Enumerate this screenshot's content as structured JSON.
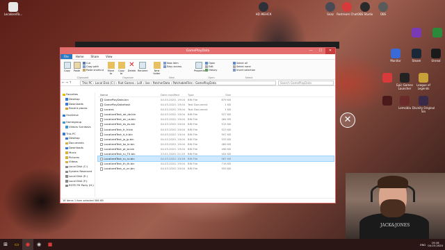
{
  "desktop": {
    "top_left_icon": {
      "label": "LocalizedTa...",
      "color": "#e8e8e8"
    },
    "top_icons": [
      {
        "label": "HD ЖЕНСК",
        "color": "#303038"
      },
      {
        "label": "Snaz",
        "color": "#4a4a55"
      },
      {
        "label": "Restream Chat",
        "color": "#d63a3a"
      },
      {
        "label": "OBS Studio",
        "color": "#2a2a2a"
      },
      {
        "label": "OBS",
        "color": "#5a5a5a"
      }
    ],
    "right_icons": [
      {
        "label": "Monitor",
        "color": "#3a6ad6"
      },
      {
        "label": "Steam",
        "color": "#1b2838"
      },
      {
        "label": "Unreal",
        "color": "#1a1a1a"
      },
      {
        "label": "",
        "color": "#7a3ab6"
      },
      {
        "label": "",
        "color": "#2a8a3a"
      },
      {
        "label": "",
        "color": "#d63a3a"
      },
      {
        "label": "Epic Games Launcher",
        "color": "#222222"
      },
      {
        "label": "League of Legends",
        "color": "#c8a03a"
      },
      {
        "label": "",
        "color": "#4a1a1a"
      },
      {
        "label": "Lemsidia",
        "color": "#6a2a2a"
      },
      {
        "label": "Divinity Original Sin",
        "color": "#3a2a4a"
      }
    ]
  },
  "overlay": {
    "close_glyph": "✕"
  },
  "explorer": {
    "title": "GamePlayData",
    "window_controls": [
      "—",
      "☐",
      "✕"
    ],
    "tabs": [
      "File",
      "Home",
      "Share",
      "View"
    ],
    "ribbon": {
      "clipboard": {
        "label": "Clipboard",
        "copy": "Copy",
        "paste": "Paste",
        "cut": "Cut",
        "copy_path": "Copy path",
        "paste_shortcut": "Paste shortcut"
      },
      "organize": {
        "label": "Organize",
        "move_to": "Move to",
        "copy_to": "Copy to",
        "delete": "Delete",
        "rename": "Rename"
      },
      "new": {
        "label": "New",
        "new_folder": "New folder",
        "new_item": "New item",
        "easy_access": "Easy access"
      },
      "open": {
        "label": "Open",
        "properties": "Properties",
        "open": "Open",
        "edit": "Edit",
        "history": "History"
      },
      "select": {
        "label": "Select",
        "select_all": "Select all",
        "select_none": "Select none",
        "invert": "Invert selection"
      }
    },
    "address": {
      "nav": "← → ↑",
      "path": "This PC  ›  Local Disk (C:)  ›  Riot Games  ›  LoR  ›  live  ›  PatcherData  ›  PatchableFiles  ›  GamePlayData",
      "search_placeholder": "Search GamePlayData"
    },
    "nav_items": [
      {
        "label": "Favorites",
        "top": true,
        "color": "#e8b800"
      },
      {
        "label": "Desktop",
        "top": false,
        "color": "#3a7ad6"
      },
      {
        "label": "Downloads",
        "top": false,
        "color": "#3a7ad6"
      },
      {
        "label": "Recent places",
        "top": false,
        "color": "#d6a030"
      },
      {
        "label": "OneDrive",
        "top": true,
        "color": "#2a7ad6",
        "gap": true
      },
      {
        "label": "Homegroup",
        "top": true,
        "color": "#3a9ad6",
        "gap": true
      },
      {
        "label": "Viktors Sviridovs",
        "top": false,
        "color": "#3a9ad6"
      },
      {
        "label": "This PC",
        "top": true,
        "color": "#3a7ad6",
        "gap": true
      },
      {
        "label": "Desktop",
        "top": false,
        "color": "#3a7ad6"
      },
      {
        "label": "Documents",
        "top": false,
        "color": "#d6b040"
      },
      {
        "label": "Downloads",
        "top": false,
        "color": "#3a7ad6"
      },
      {
        "label": "Music",
        "top": false,
        "color": "#d6b040"
      },
      {
        "label": "Pictures",
        "top": false,
        "color": "#d6b040"
      },
      {
        "label": "Videos",
        "top": false,
        "color": "#d6b040"
      },
      {
        "label": "Local Disk (C:)",
        "top": false,
        "color": "#888888"
      },
      {
        "label": "System Reserved",
        "top": false,
        "color": "#888888"
      },
      {
        "label": "Local Disk (E:)",
        "top": false,
        "color": "#888888"
      },
      {
        "label": "Local Disk (F:)",
        "top": false,
        "color": "#888888"
      },
      {
        "label": "RGTE PH Party (H:)",
        "top": false,
        "color": "#888888"
      }
    ],
    "columns": [
      "Name",
      "Date modified",
      "Type",
      "Size"
    ],
    "files": [
      {
        "name": "GamePlayData.bin",
        "date": "04.03.2020. 19:04",
        "type": "BIN File",
        "size": "879 KB",
        "selected": false
      },
      {
        "name": "GamePlayDataHash",
        "date": "04.03.2020. 19:04",
        "type": "Text Document",
        "size": "1 KB",
        "selected": false
      },
      {
        "name": "Locales",
        "date": "04.03.2020. 19:04",
        "type": "Text Document",
        "size": "1 KB",
        "selected": false
      },
      {
        "name": "LocalizedText_de_de.bin",
        "date": "04.03.2020. 19:04",
        "type": "BIN File",
        "size": "527 KB",
        "selected": false
      },
      {
        "name": "LocalizedText_en_us.bin",
        "date": "04.03.2020. 19:04",
        "type": "BIN File",
        "size": "464 KB",
        "selected": false
      },
      {
        "name": "LocalizedText_es_es.bin",
        "date": "04.03.2020. 19:04",
        "type": "BIN File",
        "size": "515 KB",
        "selected": false
      },
      {
        "name": "LocalizedText_fr_fr.bin",
        "date": "04.03.2020. 19:04",
        "type": "BIN File",
        "size": "523 KB",
        "selected": false
      },
      {
        "name": "LocalizedText_it_it.bin",
        "date": "04.03.2020. 19:04",
        "type": "BIN File",
        "size": "507 KB",
        "selected": false
      },
      {
        "name": "LocalizedText_ja_jp.bin",
        "date": "04.03.2020. 19:04",
        "type": "BIN File",
        "size": "533 KB",
        "selected": false
      },
      {
        "name": "LocalizedText_ko_kr.bin",
        "date": "04.03.2020. 19:04",
        "type": "BIN File",
        "size": "489 KB",
        "selected": false
      },
      {
        "name": "LocalizedText_pt_br.bin",
        "date": "04.03.2020. 19:04",
        "type": "BIN File",
        "size": "496 KB",
        "selected": false
      },
      {
        "name": "LocalizedText_ru_TX.bin",
        "date": "23.01.2020. 21:25",
        "type": "BIN File",
        "size": "404 KB",
        "selected": false
      },
      {
        "name": "LocalizedText_ru_ru.bin",
        "date": "04.03.2020. 19:26",
        "type": "BIN File",
        "size": "587 KB",
        "selected": true
      },
      {
        "name": "LocalizedText_th_th.bin",
        "date": "04.03.2020. 19:04",
        "type": "BIN File",
        "size": "716 KB",
        "selected": false
      },
      {
        "name": "LocalizedText_vi_vn.bin",
        "date": "04.03.2020. 19:04",
        "type": "BIN File",
        "size": "555 KB",
        "selected": false
      }
    ],
    "status": "16 items     1 item selected  586 KB"
  },
  "webcam": {
    "shirt_text": "JACK&JONES"
  },
  "taskbar": {
    "start_glyph": "⊞",
    "apps": [
      {
        "glyph": "▭",
        "color": "#e8b800",
        "active": false
      },
      {
        "glyph": "●",
        "color": "#d63a3a",
        "active": true
      },
      {
        "glyph": "◉",
        "color": "#dddddd",
        "active": false
      },
      {
        "glyph": "■",
        "color": "#d63a3a",
        "active": false
      }
    ],
    "tray": {
      "lang": "ENG",
      "time": "19:16",
      "date": "04.03.2020"
    }
  }
}
